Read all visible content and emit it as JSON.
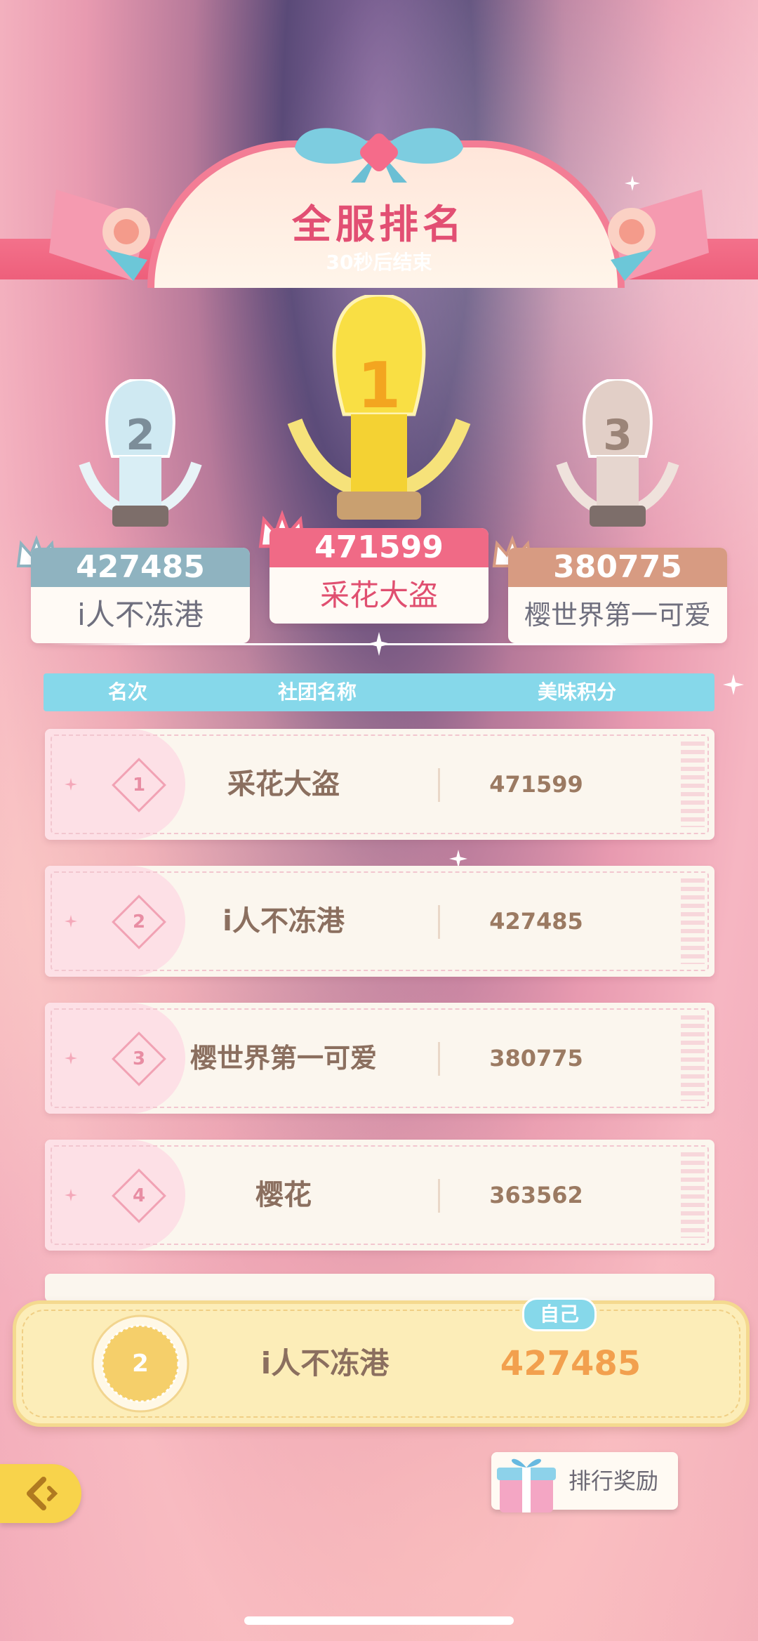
{
  "header": {
    "title": "全服排名",
    "subtitle": "30秒后结束"
  },
  "podium": [
    {
      "rank": "2",
      "score": "427485",
      "name": "i人不冻港",
      "color": "#8fb3c0"
    },
    {
      "rank": "1",
      "score": "471599",
      "name": "采花大盗",
      "color": "#f06a86"
    },
    {
      "rank": "3",
      "score": "380775",
      "name": "樱世界第一可爱",
      "color": "#d79b82"
    }
  ],
  "table": {
    "columns": [
      "名次",
      "社团名称",
      "美味积分"
    ],
    "rows": [
      {
        "rank": "1",
        "name": "采花大盗",
        "score": "471599"
      },
      {
        "rank": "2",
        "name": "i人不冻港",
        "score": "427485"
      },
      {
        "rank": "3",
        "name": "樱世界第一可爱",
        "score": "380775"
      },
      {
        "rank": "4",
        "name": "樱花",
        "score": "363562"
      }
    ]
  },
  "self": {
    "tag": "自己",
    "rank": "2",
    "name": "i人不冻港",
    "score": "427485"
  },
  "bottom": {
    "reward_label": "排行奖励"
  },
  "icons": {
    "back": "back-arrow-icon",
    "gift": "gift-icon",
    "crown": "crown-icon",
    "trophy": "trophy-icon"
  },
  "colors": {
    "accent_pink": "#ee5f7b",
    "table_header": "#86d8ea",
    "self_bg": "#fcedb8",
    "score_orange": "#f2a04e"
  }
}
